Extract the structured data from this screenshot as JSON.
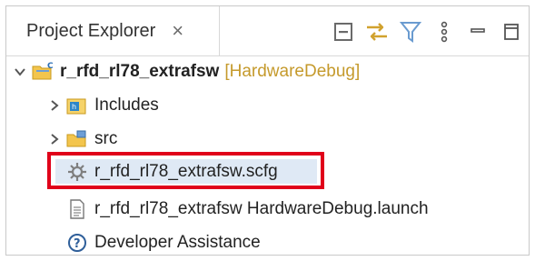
{
  "tab": {
    "title": "Project Explorer",
    "close_icon": "close-icon"
  },
  "toolbar": {
    "icons": [
      "collapse-all-icon",
      "link-with-editor-icon",
      "filter-icon",
      "view-menu-icon",
      "minimize-icon",
      "maximize-icon"
    ]
  },
  "tree": {
    "project": {
      "name": "r_rfd_rl78_extrafsw",
      "decoration": "[HardwareDebug]",
      "expanded": true
    },
    "items": [
      {
        "label": "Includes",
        "icon": "includes-folder-icon",
        "expandable": true
      },
      {
        "label": "src",
        "icon": "source-folder-icon",
        "expandable": true
      },
      {
        "label": "r_rfd_rl78_extrafsw.scfg",
        "icon": "gear-file-icon",
        "expandable": false,
        "selected": true
      },
      {
        "label": "r_rfd_rl78_extrafsw HardwareDebug.launch",
        "icon": "launch-file-icon",
        "expandable": false
      },
      {
        "label": "Developer Assistance",
        "icon": "help-icon",
        "expandable": false
      }
    ]
  },
  "colors": {
    "highlight_border": "#e0001a",
    "decoration": "#c59a2c",
    "selection": "#dfe9f5"
  }
}
